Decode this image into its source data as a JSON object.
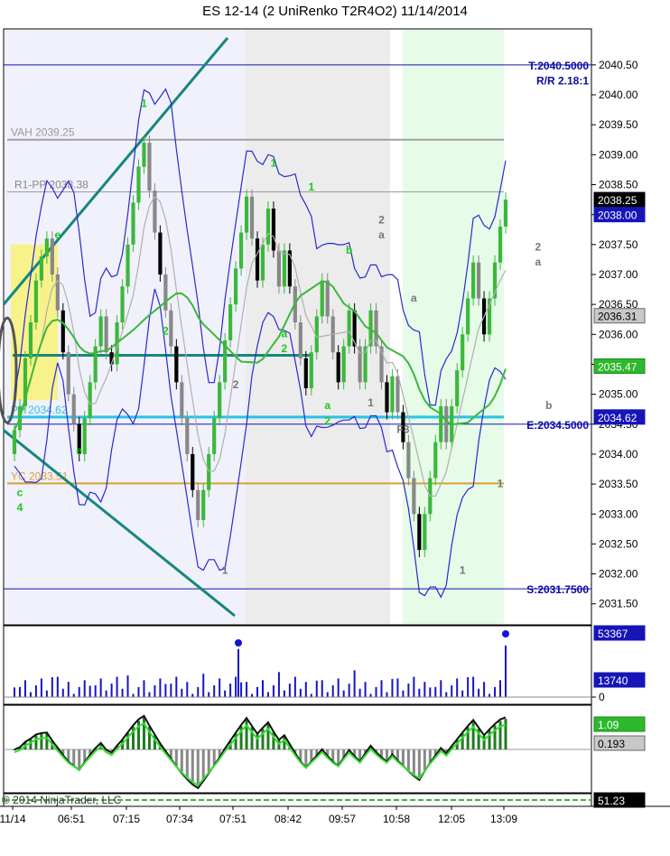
{
  "title": "ES 12-14 (2 UniRenko T2R4O2)  11/14/2014",
  "copyright": "© 2014 NinjaTrader, LLC",
  "colors": {
    "bull": "#3bb83b",
    "bear": "#000000",
    "bear_grey": "#888888",
    "band": "#2a2ad0",
    "teal": "#16877e",
    "pp": "#29c3e6",
    "yc": "#d9a036",
    "vah": "#a0a0a0",
    "axis_blue": "#1414b4"
  },
  "chart_data": [
    {
      "type": "line",
      "panel": "price",
      "y_axis_labels": [
        "2040.50",
        "2040.00",
        "2039.50",
        "2039.00",
        "2038.50",
        "2038.00",
        "2037.50",
        "2037.00",
        "2036.50",
        "2036.00",
        "2035.50",
        "2035.00",
        "2034.50",
        "2034.00",
        "2033.50",
        "2033.00",
        "2032.50",
        "2032.00",
        "2031.50"
      ],
      "ylim": [
        2031.3,
        2040.95
      ],
      "x_tick_labels": [
        "11/14",
        "06:51",
        "07:15",
        "07:34",
        "07:51",
        "08:42",
        "09:57",
        "10:58",
        "12:05",
        "13:09"
      ],
      "price_tags": [
        {
          "label": "2038.25",
          "value": 2038.25,
          "style": "black"
        },
        {
          "label": "2038.00",
          "value": 2038.0,
          "style": "blue"
        },
        {
          "label": "2036.31",
          "value": 2036.31,
          "style": "grey"
        },
        {
          "label": "2035.47",
          "value": 2035.47,
          "style": "green"
        },
        {
          "label": "2034.62",
          "value": 2034.62,
          "style": "blue"
        }
      ],
      "levels": [
        {
          "name": "VAH 2039.25",
          "value": 2039.25
        },
        {
          "name": "R1-PP 2038.38",
          "value": 2038.38
        },
        {
          "name": "PP 2034.62",
          "value": 2034.62
        },
        {
          "name": "YC 2033.51",
          "value": 2033.51
        }
      ],
      "trade_levels": [
        {
          "label": "T:2040.5000",
          "value": 2040.5
        },
        {
          "label": "R/R 2.18:1",
          "value": 2040.25
        },
        {
          "label": "E:2034.5000",
          "value": 2034.5
        },
        {
          "label": "S:2031.7500",
          "value": 2031.75
        }
      ],
      "annotations": [
        {
          "text": "1",
          "x_index": 24,
          "value": 2039.8,
          "color": "green"
        },
        {
          "text": "1",
          "x_index": 48,
          "value": 2038.8,
          "color": "green"
        },
        {
          "text": "1",
          "x_index": 55,
          "value": 2038.4,
          "color": "green"
        },
        {
          "text": "2",
          "x_index": 68,
          "value": 2037.85,
          "color": "grey"
        },
        {
          "text": "a",
          "x_index": 68,
          "value": 2037.6,
          "color": "grey"
        },
        {
          "text": "b",
          "x_index": 62,
          "value": 2037.35,
          "color": "green"
        },
        {
          "text": "a",
          "x_index": 74,
          "value": 2036.55,
          "color": "grey"
        },
        {
          "text": "2",
          "x_index": 28,
          "value": 2036.0,
          "color": "green"
        },
        {
          "text": "a",
          "x_index": 50,
          "value": 2035.95,
          "color": "green"
        },
        {
          "text": "2",
          "x_index": 50,
          "value": 2035.7,
          "color": "green"
        },
        {
          "text": "2",
          "x_index": 41,
          "value": 2035.1,
          "color": "grey"
        },
        {
          "text": "a",
          "x_index": 58,
          "value": 2034.75,
          "color": "green"
        },
        {
          "text": "2",
          "x_index": 58,
          "value": 2034.5,
          "color": "green"
        },
        {
          "text": "1",
          "x_index": 66,
          "value": 2034.8,
          "color": "grey"
        },
        {
          "text": "F3",
          "x_index": 72,
          "value": 2034.35,
          "color": "grey"
        },
        {
          "text": "e",
          "x_index": 12,
          "value": 2034.0,
          "color": "green"
        },
        {
          "text": "c",
          "x_index": 1,
          "value": 2033.3,
          "color": "green"
        },
        {
          "text": "4",
          "x_index": 1,
          "value": 2033.05,
          "color": "green"
        },
        {
          "text": "e",
          "x_index": 8,
          "value": 2037.6,
          "color": "green"
        },
        {
          "text": "1",
          "x_index": 39,
          "value": 2032.0,
          "color": "grey"
        },
        {
          "text": "1",
          "x_index": 90,
          "value": 2033.45,
          "color": "grey"
        },
        {
          "text": "1",
          "x_index": 83,
          "value": 2032.0,
          "color": "grey"
        },
        {
          "text": "2",
          "x_index": 97,
          "value": 2037.4,
          "color": "grey"
        },
        {
          "text": "a",
          "x_index": 97,
          "value": 2037.15,
          "color": "grey"
        },
        {
          "text": "b",
          "x_index": 99,
          "value": 2034.75,
          "color": "grey"
        }
      ],
      "bars": [
        {
          "open": 2034.0,
          "close": 2034.4
        },
        {
          "open": 2034.4,
          "close": 2034.8
        },
        {
          "open": 2034.8,
          "close": 2035.6
        },
        {
          "open": 2035.6,
          "close": 2036.2
        },
        {
          "open": 2036.2,
          "close": 2036.9
        },
        {
          "open": 2036.9,
          "close": 2037.3
        },
        {
          "open": 2037.3,
          "close": 2037.6
        },
        {
          "open": 2037.6,
          "close": 2037.0
        },
        {
          "open": 2037.0,
          "close": 2036.4
        },
        {
          "open": 2036.4,
          "close": 2035.7
        },
        {
          "open": 2035.7,
          "close": 2035.0
        },
        {
          "open": 2035.0,
          "close": 2034.5
        },
        {
          "open": 2034.5,
          "close": 2034.0
        },
        {
          "open": 2034.0,
          "close": 2034.6
        },
        {
          "open": 2034.6,
          "close": 2035.2
        },
        {
          "open": 2035.2,
          "close": 2035.8
        },
        {
          "open": 2035.8,
          "close": 2036.3
        },
        {
          "open": 2036.3,
          "close": 2035.7
        },
        {
          "open": 2035.7,
          "close": 2035.5
        },
        {
          "open": 2035.5,
          "close": 2036.2
        },
        {
          "open": 2036.2,
          "close": 2036.8
        },
        {
          "open": 2036.8,
          "close": 2037.5
        },
        {
          "open": 2037.5,
          "close": 2038.2
        },
        {
          "open": 2038.2,
          "close": 2038.8
        },
        {
          "open": 2038.8,
          "close": 2039.2
        },
        {
          "open": 2039.2,
          "close": 2038.4
        },
        {
          "open": 2038.4,
          "close": 2037.7
        },
        {
          "open": 2037.7,
          "close": 2037.0
        },
        {
          "open": 2037.0,
          "close": 2036.4
        },
        {
          "open": 2036.4,
          "close": 2035.8
        },
        {
          "open": 2035.8,
          "close": 2035.2
        },
        {
          "open": 2035.2,
          "close": 2034.6
        },
        {
          "open": 2034.6,
          "close": 2034.0
        },
        {
          "open": 2034.0,
          "close": 2033.4
        },
        {
          "open": 2033.4,
          "close": 2032.9
        },
        {
          "open": 2032.9,
          "close": 2033.4
        },
        {
          "open": 2033.4,
          "close": 2034.0
        },
        {
          "open": 2034.0,
          "close": 2034.6
        },
        {
          "open": 2034.6,
          "close": 2035.2
        },
        {
          "open": 2035.2,
          "close": 2035.9
        },
        {
          "open": 2035.9,
          "close": 2036.5
        },
        {
          "open": 2036.5,
          "close": 2037.1
        },
        {
          "open": 2037.1,
          "close": 2037.7
        },
        {
          "open": 2037.7,
          "close": 2038.3
        },
        {
          "open": 2038.3,
          "close": 2037.6
        },
        {
          "open": 2037.6,
          "close": 2036.9
        },
        {
          "open": 2036.9,
          "close": 2037.5
        },
        {
          "open": 2037.5,
          "close": 2038.1
        },
        {
          "open": 2038.1,
          "close": 2037.4
        },
        {
          "open": 2037.4,
          "close": 2036.8
        },
        {
          "open": 2036.8,
          "close": 2037.4
        },
        {
          "open": 2037.4,
          "close": 2036.8
        },
        {
          "open": 2036.8,
          "close": 2036.2
        },
        {
          "open": 2036.2,
          "close": 2035.6
        },
        {
          "open": 2035.6,
          "close": 2035.1
        },
        {
          "open": 2035.1,
          "close": 2035.7
        },
        {
          "open": 2035.7,
          "close": 2036.3
        },
        {
          "open": 2036.3,
          "close": 2036.9
        },
        {
          "open": 2036.9,
          "close": 2036.3
        },
        {
          "open": 2036.3,
          "close": 2035.7
        },
        {
          "open": 2035.7,
          "close": 2035.2
        },
        {
          "open": 2035.2,
          "close": 2035.8
        },
        {
          "open": 2035.8,
          "close": 2036.4
        },
        {
          "open": 2036.4,
          "close": 2035.8
        },
        {
          "open": 2035.8,
          "close": 2035.2
        },
        {
          "open": 2035.2,
          "close": 2035.8
        },
        {
          "open": 2035.8,
          "close": 2036.4
        },
        {
          "open": 2036.4,
          "close": 2035.8
        },
        {
          "open": 2035.8,
          "close": 2035.2
        },
        {
          "open": 2035.2,
          "close": 2034.7
        },
        {
          "open": 2034.7,
          "close": 2035.3
        },
        {
          "open": 2035.3,
          "close": 2034.7
        },
        {
          "open": 2034.7,
          "close": 2034.2
        },
        {
          "open": 2034.2,
          "close": 2033.6
        },
        {
          "open": 2033.6,
          "close": 2033.0
        },
        {
          "open": 2033.0,
          "close": 2032.4
        },
        {
          "open": 2032.4,
          "close": 2033.0
        },
        {
          "open": 2033.0,
          "close": 2033.6
        },
        {
          "open": 2033.6,
          "close": 2034.2
        },
        {
          "open": 2034.2,
          "close": 2034.8
        },
        {
          "open": 2034.8,
          "close": 2034.2
        },
        {
          "open": 2034.2,
          "close": 2034.8
        },
        {
          "open": 2034.8,
          "close": 2035.4
        },
        {
          "open": 2035.4,
          "close": 2036.0
        },
        {
          "open": 2036.0,
          "close": 2036.6
        },
        {
          "open": 2036.6,
          "close": 2037.2
        },
        {
          "open": 2037.2,
          "close": 2036.6
        },
        {
          "open": 2036.6,
          "close": 2036.0
        },
        {
          "open": 2036.0,
          "close": 2036.6
        },
        {
          "open": 2036.6,
          "close": 2037.2
        },
        {
          "open": 2037.2,
          "close": 2037.8
        },
        {
          "open": 2037.8,
          "close": 2038.25
        }
      ]
    },
    {
      "type": "bar",
      "panel": "volume",
      "y_axis_labels": [
        "0"
      ],
      "price_tags": [
        {
          "label": "53367",
          "value": 53367,
          "style": "blue"
        },
        {
          "label": "13740",
          "value": 13740,
          "style": "blue"
        }
      ],
      "ylim": [
        0,
        60000
      ]
    },
    {
      "type": "bar",
      "panel": "macd",
      "price_tags": [
        {
          "label": "1.09",
          "value": 1.09,
          "style": "green"
        },
        {
          "label": "0.193",
          "value": 0.193,
          "style": "grey"
        }
      ]
    },
    {
      "type": "line",
      "panel": "indicator",
      "price_tags": [
        {
          "label": "51.23",
          "value": 51.23,
          "style": "black"
        }
      ]
    }
  ]
}
